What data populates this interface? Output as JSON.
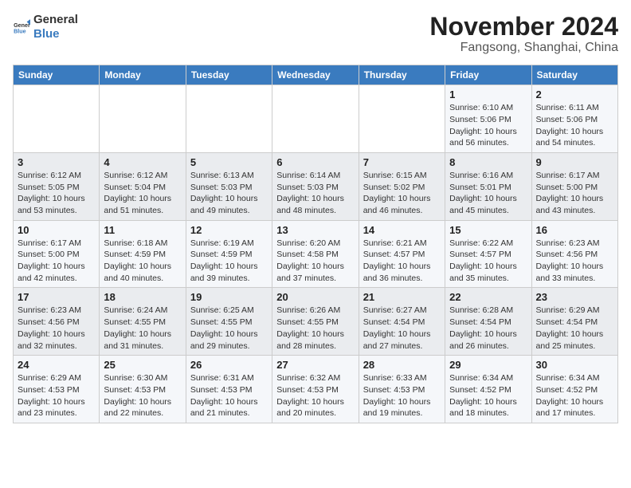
{
  "header": {
    "logo_general": "General",
    "logo_blue": "Blue",
    "title": "November 2024",
    "subtitle": "Fangsong, Shanghai, China"
  },
  "calendar": {
    "days": [
      "Sunday",
      "Monday",
      "Tuesday",
      "Wednesday",
      "Thursday",
      "Friday",
      "Saturday"
    ],
    "rows": [
      [
        {
          "day": "",
          "text": ""
        },
        {
          "day": "",
          "text": ""
        },
        {
          "day": "",
          "text": ""
        },
        {
          "day": "",
          "text": ""
        },
        {
          "day": "",
          "text": ""
        },
        {
          "day": "1",
          "text": "Sunrise: 6:10 AM\nSunset: 5:06 PM\nDaylight: 10 hours and 56 minutes."
        },
        {
          "day": "2",
          "text": "Sunrise: 6:11 AM\nSunset: 5:06 PM\nDaylight: 10 hours and 54 minutes."
        }
      ],
      [
        {
          "day": "3",
          "text": "Sunrise: 6:12 AM\nSunset: 5:05 PM\nDaylight: 10 hours and 53 minutes."
        },
        {
          "day": "4",
          "text": "Sunrise: 6:12 AM\nSunset: 5:04 PM\nDaylight: 10 hours and 51 minutes."
        },
        {
          "day": "5",
          "text": "Sunrise: 6:13 AM\nSunset: 5:03 PM\nDaylight: 10 hours and 49 minutes."
        },
        {
          "day": "6",
          "text": "Sunrise: 6:14 AM\nSunset: 5:03 PM\nDaylight: 10 hours and 48 minutes."
        },
        {
          "day": "7",
          "text": "Sunrise: 6:15 AM\nSunset: 5:02 PM\nDaylight: 10 hours and 46 minutes."
        },
        {
          "day": "8",
          "text": "Sunrise: 6:16 AM\nSunset: 5:01 PM\nDaylight: 10 hours and 45 minutes."
        },
        {
          "day": "9",
          "text": "Sunrise: 6:17 AM\nSunset: 5:00 PM\nDaylight: 10 hours and 43 minutes."
        }
      ],
      [
        {
          "day": "10",
          "text": "Sunrise: 6:17 AM\nSunset: 5:00 PM\nDaylight: 10 hours and 42 minutes."
        },
        {
          "day": "11",
          "text": "Sunrise: 6:18 AM\nSunset: 4:59 PM\nDaylight: 10 hours and 40 minutes."
        },
        {
          "day": "12",
          "text": "Sunrise: 6:19 AM\nSunset: 4:59 PM\nDaylight: 10 hours and 39 minutes."
        },
        {
          "day": "13",
          "text": "Sunrise: 6:20 AM\nSunset: 4:58 PM\nDaylight: 10 hours and 37 minutes."
        },
        {
          "day": "14",
          "text": "Sunrise: 6:21 AM\nSunset: 4:57 PM\nDaylight: 10 hours and 36 minutes."
        },
        {
          "day": "15",
          "text": "Sunrise: 6:22 AM\nSunset: 4:57 PM\nDaylight: 10 hours and 35 minutes."
        },
        {
          "day": "16",
          "text": "Sunrise: 6:23 AM\nSunset: 4:56 PM\nDaylight: 10 hours and 33 minutes."
        }
      ],
      [
        {
          "day": "17",
          "text": "Sunrise: 6:23 AM\nSunset: 4:56 PM\nDaylight: 10 hours and 32 minutes."
        },
        {
          "day": "18",
          "text": "Sunrise: 6:24 AM\nSunset: 4:55 PM\nDaylight: 10 hours and 31 minutes."
        },
        {
          "day": "19",
          "text": "Sunrise: 6:25 AM\nSunset: 4:55 PM\nDaylight: 10 hours and 29 minutes."
        },
        {
          "day": "20",
          "text": "Sunrise: 6:26 AM\nSunset: 4:55 PM\nDaylight: 10 hours and 28 minutes."
        },
        {
          "day": "21",
          "text": "Sunrise: 6:27 AM\nSunset: 4:54 PM\nDaylight: 10 hours and 27 minutes."
        },
        {
          "day": "22",
          "text": "Sunrise: 6:28 AM\nSunset: 4:54 PM\nDaylight: 10 hours and 26 minutes."
        },
        {
          "day": "23",
          "text": "Sunrise: 6:29 AM\nSunset: 4:54 PM\nDaylight: 10 hours and 25 minutes."
        }
      ],
      [
        {
          "day": "24",
          "text": "Sunrise: 6:29 AM\nSunset: 4:53 PM\nDaylight: 10 hours and 23 minutes."
        },
        {
          "day": "25",
          "text": "Sunrise: 6:30 AM\nSunset: 4:53 PM\nDaylight: 10 hours and 22 minutes."
        },
        {
          "day": "26",
          "text": "Sunrise: 6:31 AM\nSunset: 4:53 PM\nDaylight: 10 hours and 21 minutes."
        },
        {
          "day": "27",
          "text": "Sunrise: 6:32 AM\nSunset: 4:53 PM\nDaylight: 10 hours and 20 minutes."
        },
        {
          "day": "28",
          "text": "Sunrise: 6:33 AM\nSunset: 4:53 PM\nDaylight: 10 hours and 19 minutes."
        },
        {
          "day": "29",
          "text": "Sunrise: 6:34 AM\nSunset: 4:52 PM\nDaylight: 10 hours and 18 minutes."
        },
        {
          "day": "30",
          "text": "Sunrise: 6:34 AM\nSunset: 4:52 PM\nDaylight: 10 hours and 17 minutes."
        }
      ]
    ]
  }
}
